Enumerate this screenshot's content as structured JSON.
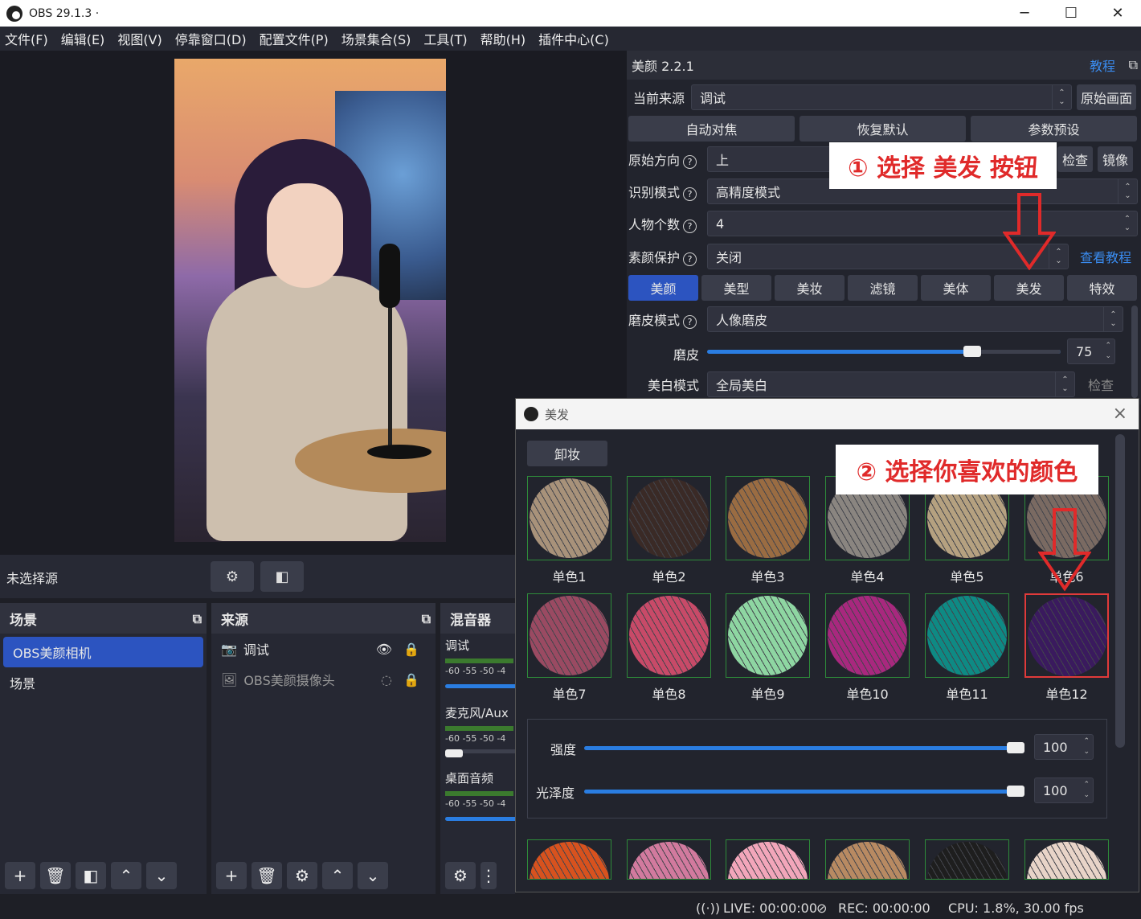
{
  "window": {
    "title": "OBS 29.1.3 ·",
    "min": "─",
    "max": "☐",
    "close": "✕"
  },
  "menu": [
    "文件(F)",
    "编辑(E)",
    "视图(V)",
    "停靠窗口(D)",
    "配置文件(P)",
    "场景集合(S)",
    "工具(T)",
    "帮助(H)",
    "插件中心(C)"
  ],
  "source_bar": {
    "label": "未选择源"
  },
  "scenes": {
    "title": "场景",
    "items": [
      "OBS美颜相机",
      "场景"
    ]
  },
  "sources": {
    "title": "来源",
    "items": [
      "调试",
      "OBS美颜摄像头"
    ]
  },
  "mixer": {
    "title": "混音器",
    "channels": [
      {
        "name": "调试"
      },
      {
        "name": "麦克风/Aux"
      },
      {
        "name": "桌面音频"
      }
    ],
    "ticks": "-60  -55  -50  -4"
  },
  "beauty": {
    "title": "美颜 2.2.1",
    "tutorial": "教程",
    "current_source_label": "当前来源",
    "current_source": "调试",
    "original_btn": "原始画面",
    "auto_focus": "自动对焦",
    "restore": "恢复默认",
    "preset": "参数预设",
    "orientation_label": "原始方向",
    "orientation": "上",
    "check": "检查",
    "mirror": "镜像",
    "recog_label": "识别模式",
    "recog": "高精度模式",
    "people_label": "人物个数",
    "people": "4",
    "protect_label": "素颜保护",
    "protect": "关闭",
    "view_tutorial": "查看教程",
    "tabs": [
      "美颜",
      "美型",
      "美妆",
      "滤镜",
      "美体",
      "美发",
      "特效"
    ],
    "smooth_mode_label": "磨皮模式",
    "smooth_mode": "人像磨皮",
    "smooth_label": "磨皮",
    "smooth_value": "75",
    "smooth_level": 0.75,
    "white_label": "美白模式",
    "white": "全局美白",
    "white_check": "检查"
  },
  "hair_dialog": {
    "title": "美发",
    "clear": "卸妆",
    "swatches": [
      {
        "label": "单色1",
        "color": "#a8927a"
      },
      {
        "label": "单色2",
        "color": "#3a2a26"
      },
      {
        "label": "单色3",
        "color": "#9a6c42"
      },
      {
        "label": "单色4",
        "color": "#8a8580"
      },
      {
        "label": "单色5",
        "color": "#b5a180"
      },
      {
        "label": "单色6",
        "color": "#7a6a62"
      },
      {
        "label": "单色7",
        "color": "#9a4a62"
      },
      {
        "label": "单色8",
        "color": "#c84a68"
      },
      {
        "label": "单色9",
        "color": "#8ed6a2"
      },
      {
        "label": "单色10",
        "color": "#a8287e"
      },
      {
        "label": "单色11",
        "color": "#0e8a84"
      },
      {
        "label": "单色12",
        "color": "#3a1a5e"
      }
    ],
    "bottom_colors": [
      "#d8521e",
      "#d27a9e",
      "#f2a6ba",
      "#b88a62",
      "#1e1e1e",
      "#e8d4c8"
    ],
    "strength_label": "强度",
    "strength": "100",
    "strength_level": 1.0,
    "gloss_label": "光泽度",
    "gloss": "100",
    "gloss_level": 1.0
  },
  "annotations": {
    "step1": "① 选择 美发 按钮",
    "step2": "② 选择你喜欢的颜色"
  },
  "status": {
    "live": "LIVE: 00:00:00",
    "rec": "REC: 00:00:00",
    "cpu": "CPU: 1.8%, 30.00 fps"
  }
}
